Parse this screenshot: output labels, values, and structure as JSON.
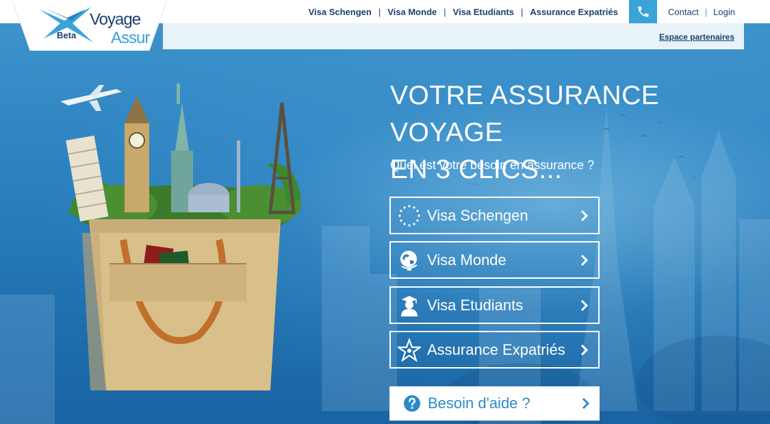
{
  "brand": {
    "word1": "Voyage",
    "word2": "Assur",
    "tag": "Beta"
  },
  "topnav": {
    "items": [
      {
        "label": "Visa Schengen"
      },
      {
        "label": "Visa Monde"
      },
      {
        "label": "Visa Etudiants"
      },
      {
        "label": "Assurance Expatriés"
      }
    ],
    "separator": "|",
    "contact": "Contact",
    "login": "Login",
    "partner_link": "Espace partenaires"
  },
  "hero": {
    "headline_line1": "VOTRE ASSURANCE VOYAGE",
    "headline_line2": "EN 3 CLICS...",
    "question": "Quel est votre besoin en assurance ?"
  },
  "choices": [
    {
      "label": "Visa Schengen",
      "icon": "eu-stars-icon"
    },
    {
      "label": "Visa Monde",
      "icon": "globe-icon"
    },
    {
      "label": "Visa Etudiants",
      "icon": "graduate-icon"
    },
    {
      "label": "Assurance Expatriés",
      "icon": "star-emblem-icon"
    }
  ],
  "help": {
    "label": "Besoin d'aide ?",
    "icon": "question-circle-icon"
  },
  "colors": {
    "navy": "#1b3f70",
    "accent": "#3aa3d8",
    "hero_blue": "#2c82c0"
  }
}
